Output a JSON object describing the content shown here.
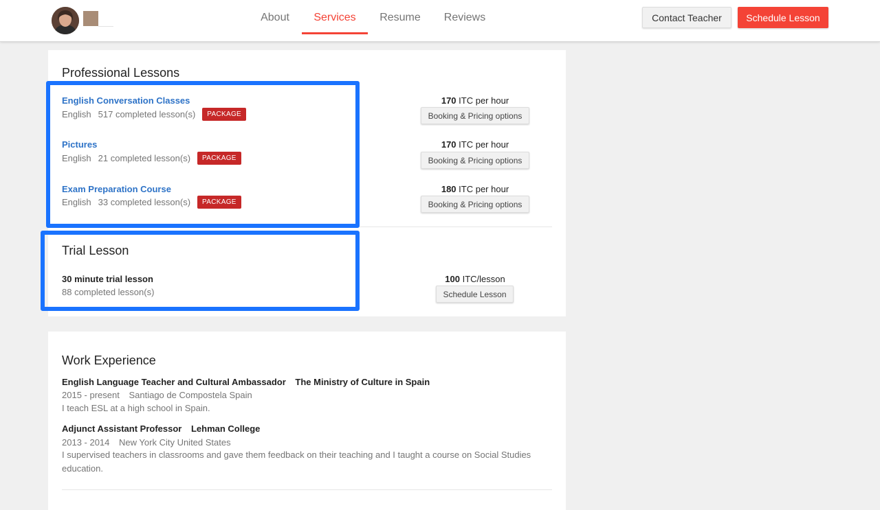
{
  "header": {
    "nav": [
      "About",
      "Services",
      "Resume",
      "Reviews"
    ],
    "active_tab": "Services",
    "contact_label": "Contact Teacher",
    "schedule_label": "Schedule Lesson"
  },
  "colors": {
    "accent": "#f44336",
    "link": "#2e73c7",
    "badge": "#c62828",
    "highlight": "#1a73ff"
  },
  "professional": {
    "title": "Professional Lessons",
    "lessons": [
      {
        "name": "English Conversation Classes",
        "language": "English",
        "completed": "517 completed lesson(s)",
        "badge": "PACKAGE",
        "price_value": "170",
        "price_unit": "ITC per hour",
        "button": "Booking & Pricing options"
      },
      {
        "name": "Pictures",
        "language": "English",
        "completed": "21 completed lesson(s)",
        "badge": "PACKAGE",
        "price_value": "170",
        "price_unit": "ITC per hour",
        "button": "Booking & Pricing options"
      },
      {
        "name": "Exam Preparation Course",
        "language": "English",
        "completed": "33 completed lesson(s)",
        "badge": "PACKAGE",
        "price_value": "180",
        "price_unit": "ITC per hour",
        "button": "Booking & Pricing options"
      }
    ]
  },
  "trial": {
    "title": "Trial Lesson",
    "name": "30 minute trial lesson",
    "completed": "88 completed lesson(s)",
    "price_value": "100",
    "price_unit": "ITC/lesson",
    "button": "Schedule Lesson"
  },
  "work": {
    "title": "Work Experience",
    "jobs": [
      {
        "role": "English Language Teacher and Cultural Ambassador",
        "org": "The Ministry of Culture in Spain",
        "dates": "2015 - present",
        "location": "Santiago de Compostela Spain",
        "description": "I teach ESL at a high school in Spain."
      },
      {
        "role": "Adjunct Assistant Professor",
        "org": "Lehman College",
        "dates": "2013 - 2014",
        "location": "New York City United States",
        "description": "I supervised teachers in classrooms and gave them feedback on their teaching and I taught a course on Social Studies education."
      }
    ]
  }
}
